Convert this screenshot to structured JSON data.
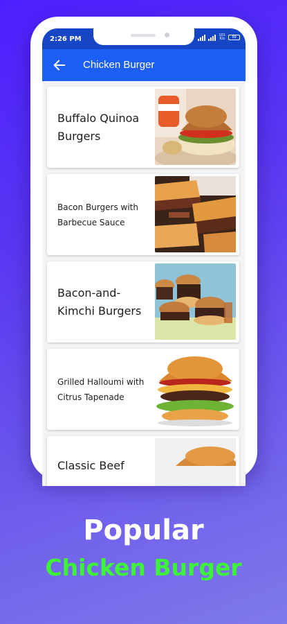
{
  "status_bar": {
    "time": "2:26 PM",
    "net_speed_value": "101",
    "net_speed_unit": "K/s",
    "battery": "99"
  },
  "app_bar": {
    "title": "Chicken Burger",
    "back_icon": "arrow-left-icon"
  },
  "recipes": [
    {
      "title": "Buffalo Quinoa Burgers"
    },
    {
      "title": "Bacon Burgers with Barbecue Sauce"
    },
    {
      "title": "Bacon-and-Kimchi Burgers"
    },
    {
      "title": "Grilled Halloumi with Citrus Tapenade"
    },
    {
      "title": "Classic Beef"
    }
  ],
  "caption": {
    "line1": "Popular",
    "line2": "Chicken Burger"
  },
  "colors": {
    "status_bar": "#1646c5",
    "app_bar": "#1d5ef4",
    "caption_line2": "#3df33a",
    "background_start": "#4d1fff",
    "background_end": "#7f79ea"
  }
}
